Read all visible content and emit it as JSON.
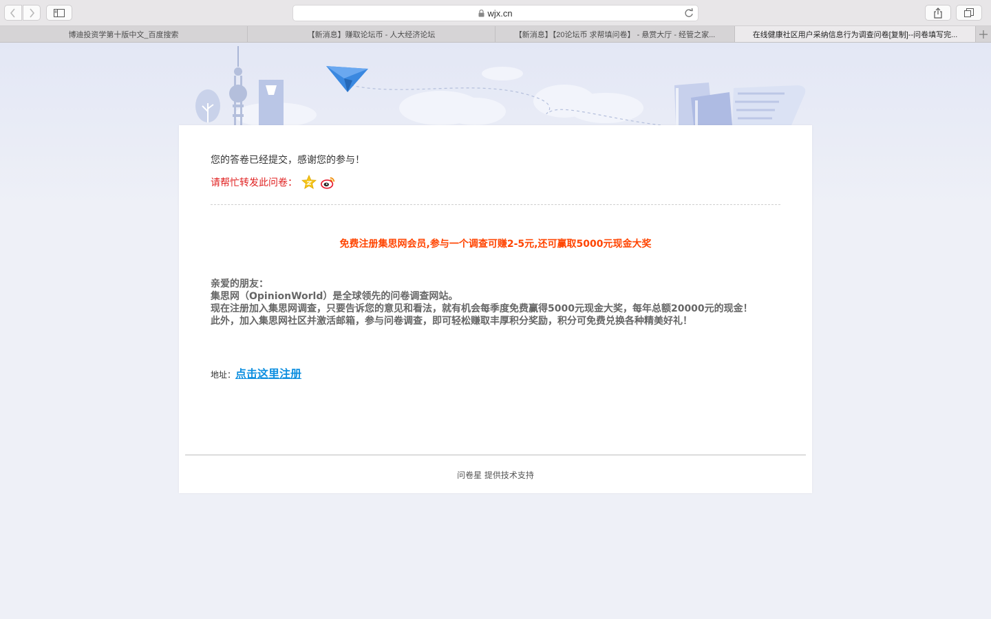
{
  "browser": {
    "address": "wjx.cn",
    "tabs": [
      {
        "label": "博迪投资学第十版中文_百度搜索"
      },
      {
        "label": "【新消息】赚取论坛币 - 人大经济论坛"
      },
      {
        "label": "【新消息】【20论坛币 求帮填问卷】 - 悬赏大厅 - 经管之家..."
      },
      {
        "label": "在线健康社区用户采纳信息行为调查问卷[复制]--问卷填写完..."
      }
    ]
  },
  "main": {
    "thanks_message": "您的答卷已经提交，感谢您的参与！",
    "share_label": "请帮忙转发此问卷：",
    "promo_title": "免费注册集思网会员,参与一个调查可赚2-5元,还可赢取5000元现金大奖",
    "friend_lines": [
      "亲爱的朋友：",
      "集思网（OpinionWorld）是全球领先的问卷调查网站。",
      "现在注册加入集思网调查，只要告诉您的意见和看法，就有机会每季度免费赢得5000元现金大奖，每年总额20000元的现金！",
      "此外，加入集思网社区并激活邮箱，参与问卷调查，即可轻松赚取丰厚积分奖励，积分可免费兑换各种精美好礼！"
    ],
    "address_label": "地址：",
    "register_link": "点击这里注册"
  },
  "footer": {
    "text": "问卷星 提供技术支持"
  },
  "colors": {
    "accent_red": "#e02020",
    "promo_orange": "#ff4400",
    "link_blue": "#0e8fe0"
  }
}
